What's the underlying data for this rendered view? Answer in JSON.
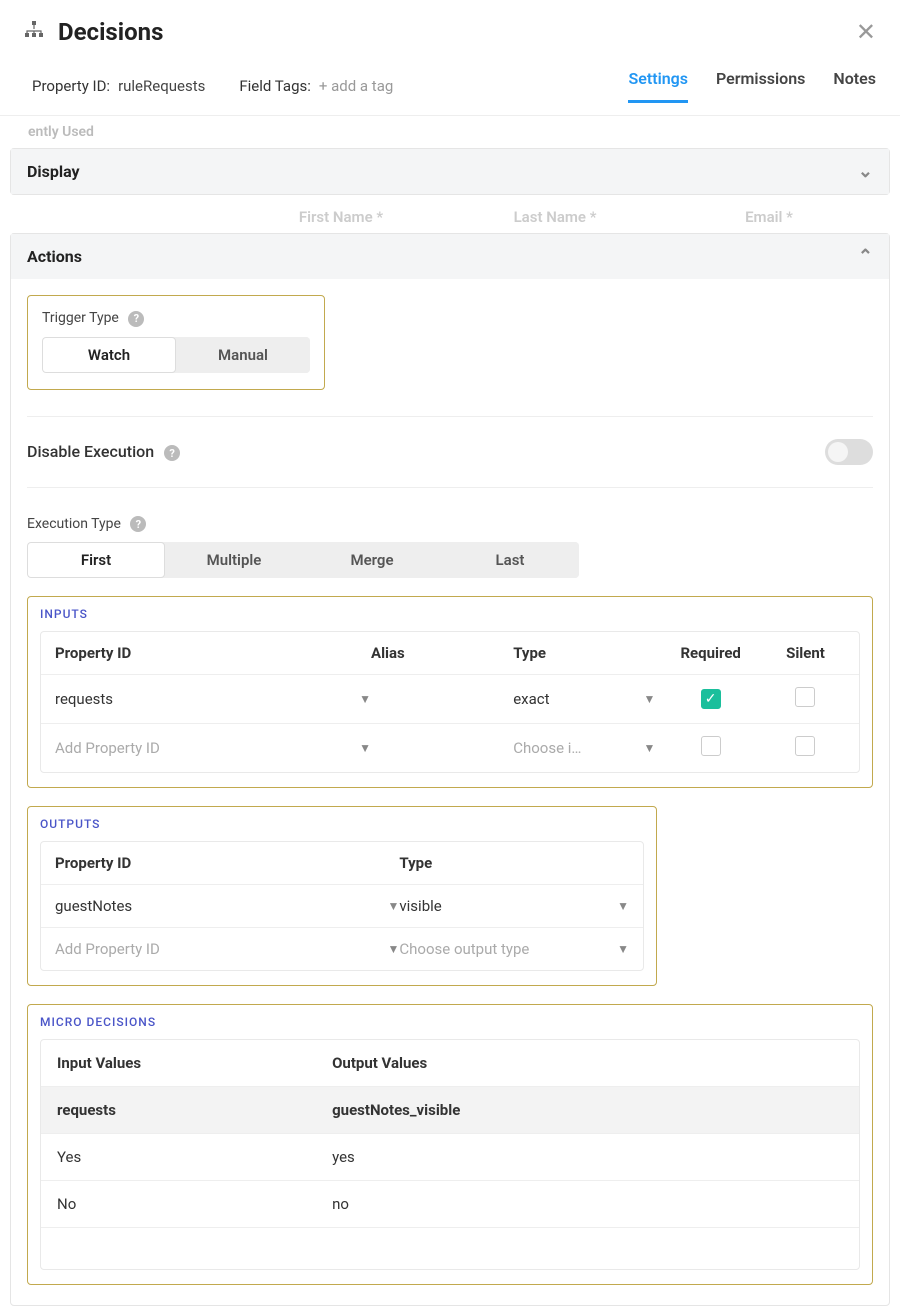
{
  "header": {
    "title": "Decisions"
  },
  "subheader": {
    "propIdLabel": "Property ID:",
    "propIdValue": "ruleRequests",
    "fieldTagsLabel": "Field Tags:",
    "addTagPlaceholder": "+ add a tag"
  },
  "tabs": {
    "t0": "Settings",
    "t1": "Permissions",
    "t2": "Notes"
  },
  "bgHints": {
    "left": "ently Used",
    "c1": "First Name *",
    "c2": "Last Name *",
    "c3": "Email *"
  },
  "panels": {
    "display": "Display",
    "actions": "Actions"
  },
  "actions": {
    "triggerTypeLabel": "Trigger Type",
    "trigger": {
      "watch": "Watch",
      "manual": "Manual"
    },
    "disableExecLabel": "Disable Execution",
    "executionTypeLabel": "Execution Type",
    "exec": {
      "first": "First",
      "multiple": "Multiple",
      "merge": "Merge",
      "last": "Last"
    },
    "inputsTitle": "INPUTS",
    "inputs": {
      "headers": {
        "prop": "Property ID",
        "alias": "Alias",
        "type": "Type",
        "required": "Required",
        "silent": "Silent"
      },
      "row1": {
        "prop": "requests",
        "type": "exact"
      },
      "addPlaceholder": "Add Property ID",
      "chooseTypePlaceholder": "Choose i…"
    },
    "outputsTitle": "OUTPUTS",
    "outputs": {
      "headers": {
        "prop": "Property ID",
        "type": "Type"
      },
      "row1": {
        "prop": "guestNotes",
        "type": "visible"
      },
      "addPlaceholder": "Add Property ID",
      "chooseTypePlaceholder": "Choose output type"
    },
    "microTitle": "MICRO DECISIONS",
    "micro": {
      "headers": {
        "in": "Input Values",
        "out": "Output Values"
      },
      "sub": {
        "in": "requests",
        "out": "guestNotes_visible"
      },
      "rows": [
        {
          "in": "Yes",
          "out": "yes"
        },
        {
          "in": "No",
          "out": "no"
        }
      ]
    }
  }
}
